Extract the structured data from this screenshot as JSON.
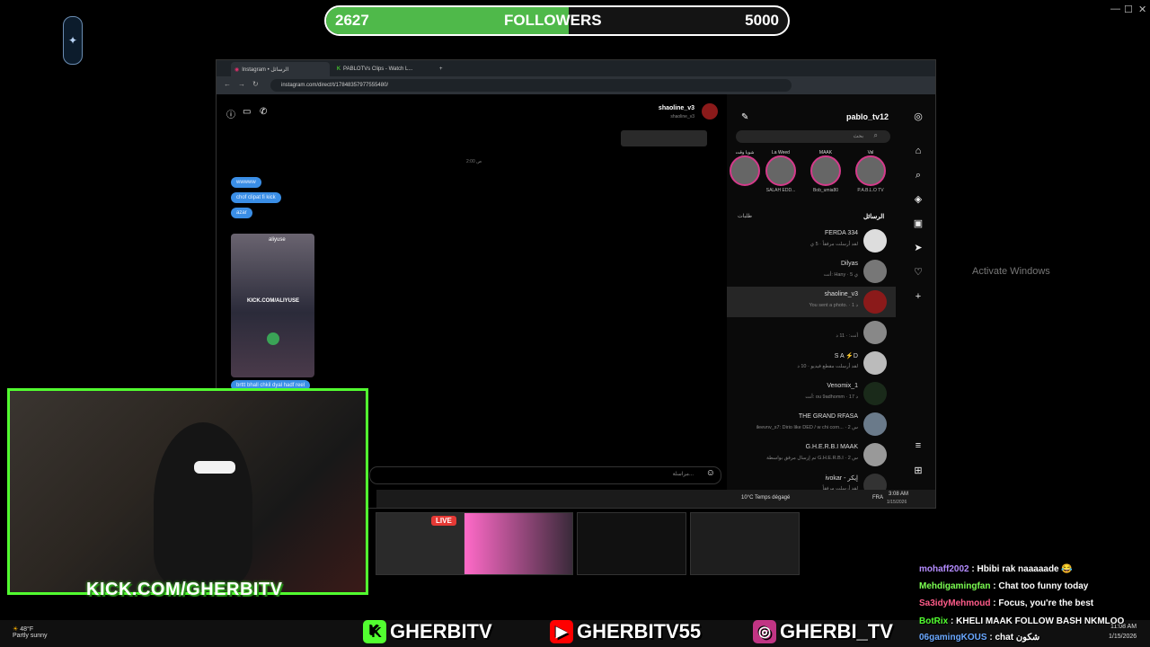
{
  "followers": {
    "current": "2627",
    "label": "FOLLOWERS",
    "goal": "5000",
    "progress": 0.5254,
    "fill_color": "#4fb94a"
  },
  "window_controls": {
    "minimize": "—",
    "maximize": "☐",
    "close": "✕"
  },
  "browser": {
    "tabs": [
      {
        "label": "Instagram • الرسائل"
      },
      {
        "label": "PABLOTVs Clips - Watch L..."
      }
    ],
    "new_tab": "+",
    "url": "instagram.com/direct/t/17848357977555480/"
  },
  "chat": {
    "header_name": "shaoline_v3",
    "header_sub": "shaoline_v3",
    "timestamp": "2:00 ص",
    "messages": [
      "wwwww",
      "chof clipat fi kick",
      "azar"
    ],
    "reel_user": "aliyuse",
    "reel_caption": "KICK.COM/ALIYUSE",
    "last_message": "brttt bhall chkil dyal hadf reel",
    "input_placeholder": "مراسلة..."
  },
  "sidebar": {
    "username": "pablo_tv12",
    "search_placeholder": "بحث",
    "stories": [
      {
        "note": "شويا وقت",
        "label": ""
      },
      {
        "note": "La Weed",
        "label": "SALAH EDD..."
      },
      {
        "note": "MAAK",
        "label": "Bob_umia80"
      },
      {
        "note": "Val",
        "label": "P.A.B.L.O TV"
      }
    ],
    "messages_heading": "الرسائل",
    "requests_heading": "طلبات",
    "conversations": [
      {
        "name": "FERDA 334",
        "sub": "لقد أرسلت مرفقاً · 5 ي"
      },
      {
        "name": "Dilyas",
        "sub": "أنت: Hany · 5 ي"
      },
      {
        "name": "shaoline_v3",
        "sub": "You sent a photo. · 1 د"
      },
      {
        "name": "",
        "sub": "أنت: · 11 د"
      },
      {
        "name": "S A ⚡D",
        "sub": "لقد أرسلت مقطع فيديو · 10 د"
      },
      {
        "name": "Venomix_1",
        "sub": "أنت: ou 9adhomm · 17 د"
      },
      {
        "name": "THE GRAND RFASA",
        "sub": "ileevnv_s7: Dirio like DED / w chi corn... · 2 س"
      },
      {
        "name": "G.H.E.R.B.I MAAK",
        "sub": "تم إرسال مرفق بواسطة G.H.E.R.B.I · 2 س"
      },
      {
        "name": "ivokar - إيكر",
        "sub": "لقد أرسلت مرفقاً"
      }
    ]
  },
  "webcam": {
    "url_text": "KICK.COM/GHERBITV"
  },
  "inner_taskbar": {
    "weather": "10°C Temps dégagé",
    "lang": "FRA",
    "time": "3:08 AM",
    "date": "1/15/2026"
  },
  "thumbnails": {
    "live_badge": "LIVE"
  },
  "chat_overlay": [
    {
      "user": "mohaff2002",
      "msg": ": Hbibi rak naaaaade 😂",
      "color": "#b48cff"
    },
    {
      "user": "Mehdigamingfan",
      "msg": ": Chat too funny today",
      "color": "#7cff52"
    },
    {
      "user": "Sa3idyMehmoud",
      "msg": ": Focus, you're the best",
      "color": "#ff5c8a"
    },
    {
      "user": "BotRix",
      "msg": ": KHELI MAAK FOLLOW BASH NKMLOO",
      "color": "#52ff30"
    },
    {
      "user": "06gamingKOUS",
      "msg": ": chat شكون",
      "color": "#6aa8ff"
    }
  ],
  "social": [
    {
      "name": "GHERBITV",
      "icon": "K",
      "bg": "#52ff30",
      "fg": "#000"
    },
    {
      "name": "GHERBITV55",
      "icon": "▶",
      "bg": "#ff0000",
      "fg": "#fff"
    },
    {
      "name": "GHERBI_TV",
      "icon": "◎",
      "bg": "#c13584",
      "fg": "#fff"
    }
  ],
  "taskbar": {
    "temp": "48°F",
    "condition": "Partly sunny",
    "time": "11:08 AM",
    "date": "1/15/2026",
    "activate": "Activate Windows"
  }
}
